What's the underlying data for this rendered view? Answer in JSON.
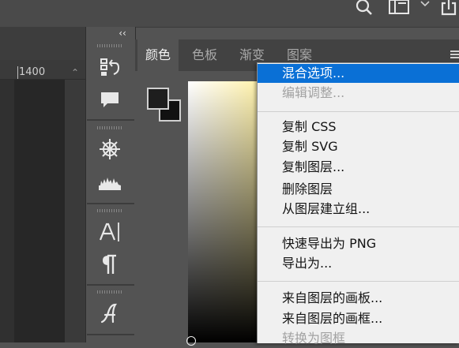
{
  "ruler": {
    "label": "1400"
  },
  "dock": {
    "collapse_glyph": "‹‹"
  },
  "color_panel": {
    "tabs": [
      "颜色",
      "色板",
      "渐变",
      "图案"
    ],
    "foreground_color": "#1e1e1e",
    "background_color": "#111111"
  },
  "context_menu": {
    "items": [
      {
        "label": "混合选项...",
        "state": "highlighted"
      },
      {
        "label": "编辑调整...",
        "state": "disabled"
      },
      {
        "label": "复制 CSS",
        "state": "enabled"
      },
      {
        "label": "复制 SVG",
        "state": "enabled"
      },
      {
        "label": "复制图层...",
        "state": "enabled"
      },
      {
        "label": "删除图层",
        "state": "enabled"
      },
      {
        "label": "从图层建立组...",
        "state": "enabled"
      },
      {
        "label": "快速导出为 PNG",
        "state": "enabled"
      },
      {
        "label": "导出为...",
        "state": "enabled"
      },
      {
        "label": "来自图层的画板...",
        "state": "enabled"
      },
      {
        "label": "来自图层的画框...",
        "state": "enabled"
      },
      {
        "label": "转换为图框",
        "state": "disabled"
      }
    ]
  },
  "colors": {
    "highlight": "#0a70d6",
    "menu_bg": "#f0f0f0",
    "panel_bg": "#535353"
  },
  "icons": [
    "search-icon",
    "workspace-icon",
    "chevron-down-icon",
    "share-icon",
    "history-icon",
    "comments-icon",
    "properties-icon",
    "histogram-icon",
    "character-icon",
    "paragraph-icon",
    "glyphs-icon",
    "panel-menu-icon"
  ]
}
